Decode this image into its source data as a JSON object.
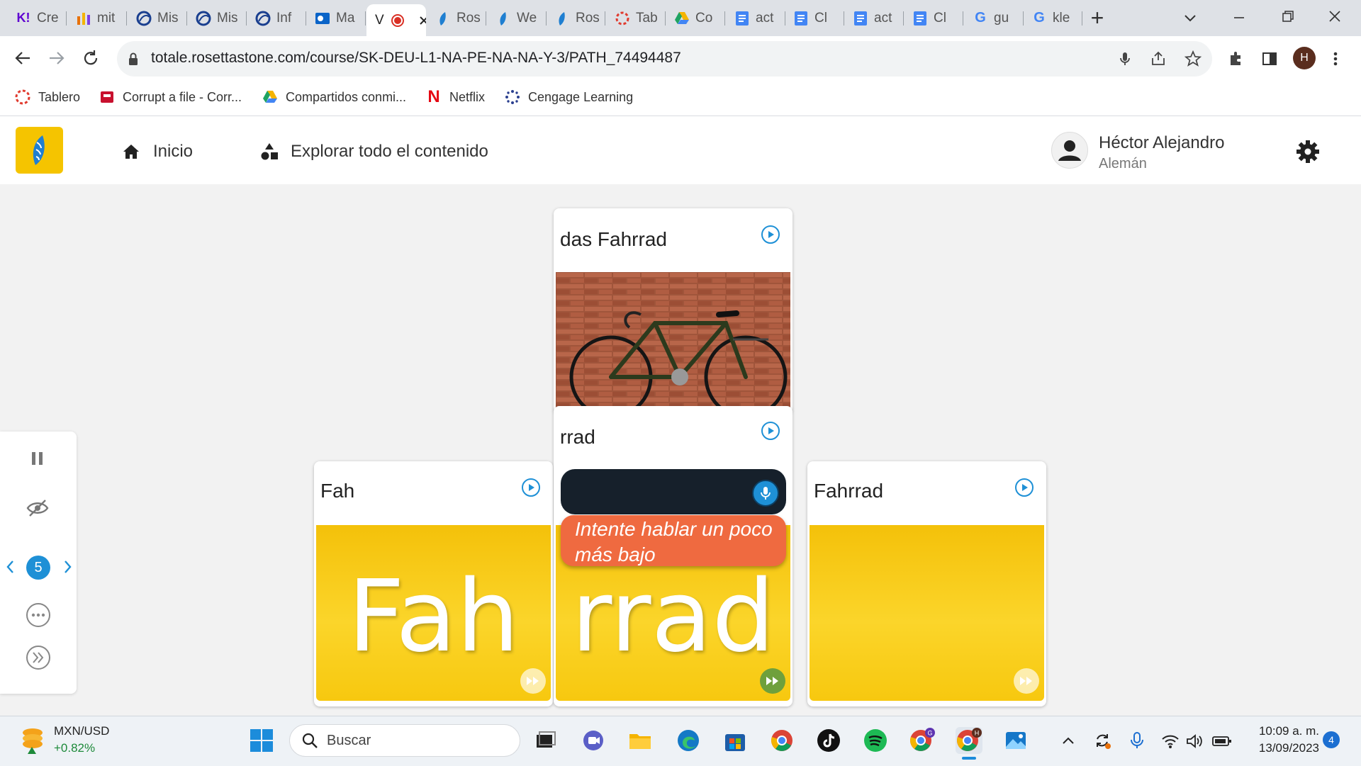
{
  "browser": {
    "tabs": [
      {
        "label": "Cre",
        "icon": "yahoo-icon"
      },
      {
        "label": "mit",
        "icon": "chart-bars-icon"
      },
      {
        "label": "Mis",
        "icon": "globe-icon"
      },
      {
        "label": "Mis",
        "icon": "globe-icon"
      },
      {
        "label": "Inf",
        "icon": "globe-icon"
      },
      {
        "label": "Ma",
        "icon": "outlook-icon"
      },
      {
        "label": "V",
        "icon": "recording-icon",
        "active": true
      },
      {
        "label": "Ros",
        "icon": "rosetta-icon"
      },
      {
        "label": "We",
        "icon": "rosetta-icon"
      },
      {
        "label": "Ros",
        "icon": "rosetta-icon"
      },
      {
        "label": "Tab",
        "icon": "canvas-icon"
      },
      {
        "label": "Co",
        "icon": "drive-icon"
      },
      {
        "label": "act",
        "icon": "docs-icon"
      },
      {
        "label": "Cl",
        "icon": "docs-icon"
      },
      {
        "label": "act",
        "icon": "docs-icon"
      },
      {
        "label": "Cl",
        "icon": "docs-icon"
      },
      {
        "label": "gu",
        "icon": "google-icon"
      },
      {
        "label": "kle",
        "icon": "google-icon"
      }
    ],
    "new_tab": "+",
    "url": "totale.rosettastone.com/course/SK-DEU-L1-NA-PE-NA-NA-Y-3/PATH_74494487",
    "profile_initial": "H",
    "bookmarks": [
      {
        "label": "Tablero",
        "icon": "canvas-icon"
      },
      {
        "label": "Corrupt a file - Corr...",
        "icon": "file-icon"
      },
      {
        "label": "Compartidos conmi...",
        "icon": "drive-icon"
      },
      {
        "label": "Netflix",
        "icon": "netflix-icon"
      },
      {
        "label": "Cengage Learning",
        "icon": "cengage-icon"
      }
    ]
  },
  "app": {
    "nav": {
      "home": "Inicio",
      "explore": "Explorar todo el contenido"
    },
    "user": {
      "name": "Héctor Alejandro",
      "language": "Alemán"
    },
    "cards": {
      "top": {
        "title": "das Fahrrad"
      },
      "middle": {
        "title": "rrad",
        "big_word": "rrad"
      },
      "left": {
        "title": "Fah",
        "big_word": "Fah"
      },
      "right": {
        "title": "Fahrrad",
        "big_word": ""
      }
    },
    "feedback": "Intente hablar un poco más bajo",
    "pager": {
      "current": "5"
    },
    "colors": {
      "accent": "#1e90d6",
      "card_yellow": "#f7c80f",
      "feedback_bg": "#ef6a40",
      "mic_bar": "#16202b",
      "ff_active": "#6fa03c"
    }
  },
  "taskbar": {
    "ticker": {
      "pair": "MXN/USD",
      "change": "+0.82%"
    },
    "search_placeholder": "Buscar",
    "clock": {
      "time": "10:09 a. m.",
      "date": "13/09/2023"
    },
    "notifications": "4"
  }
}
